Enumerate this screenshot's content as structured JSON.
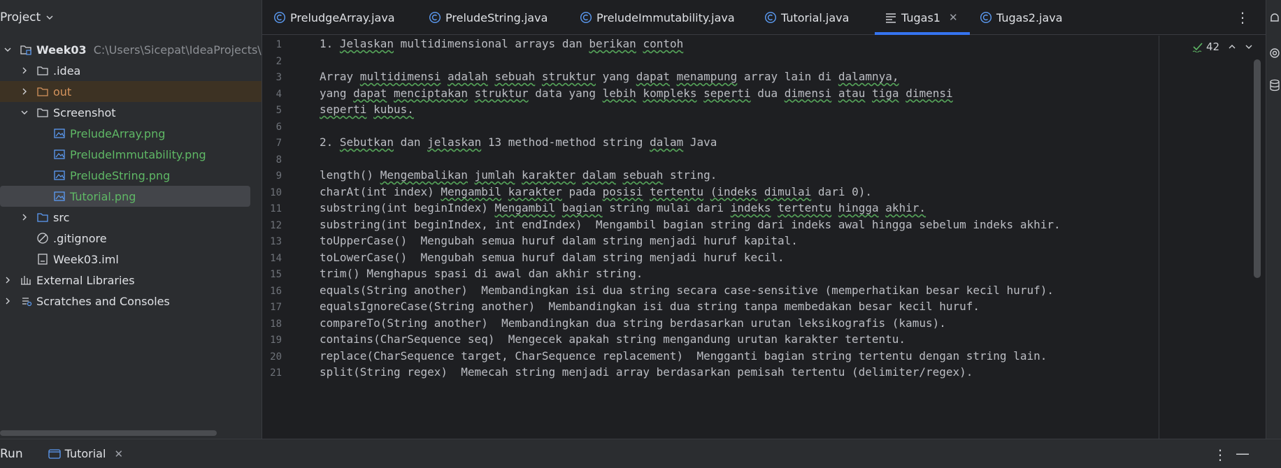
{
  "project": {
    "title": "Project",
    "tree": [
      {
        "label": "Week03",
        "path": "C:\\Users\\Sicepat\\IdeaProjects\\W",
        "icon": "module-folder-icon"
      },
      {
        "label": ".idea",
        "icon": "folder-icon"
      },
      {
        "label": "out",
        "icon": "folder-icon"
      },
      {
        "label": "Screenshot",
        "icon": "folder-icon"
      },
      {
        "label": "PreludeArray.png",
        "icon": "image-file-icon"
      },
      {
        "label": "PreludeImmutability.png",
        "icon": "image-file-icon"
      },
      {
        "label": "PreludeString.png",
        "icon": "image-file-icon"
      },
      {
        "label": "Tutorial.png",
        "icon": "image-file-icon"
      },
      {
        "label": "src",
        "icon": "folder-icon"
      },
      {
        "label": ".gitignore",
        "icon": "ignore-file-icon"
      },
      {
        "label": "Week03.iml",
        "icon": "iml-file-icon"
      },
      {
        "label": "External Libraries",
        "icon": "libraries-icon"
      },
      {
        "label": "Scratches and Consoles",
        "icon": "scratches-icon"
      }
    ]
  },
  "tabs": [
    {
      "label": "PreludgeArray.java",
      "icon": "java-class-icon"
    },
    {
      "label": "PreludeString.java",
      "icon": "java-class-icon"
    },
    {
      "label": "PreludeImmutability.java",
      "icon": "java-class-icon"
    },
    {
      "label": "Tutorial.java",
      "icon": "java-class-icon"
    },
    {
      "label": "Tugas1",
      "icon": "text-file-icon",
      "active": true
    },
    {
      "label": "Tugas2.java",
      "icon": "java-class-icon"
    }
  ],
  "editor": {
    "inspection_count": "42",
    "line_numbers": [
      "1",
      "2",
      "3",
      "4",
      "5",
      "6",
      "7",
      "8",
      "9",
      "10",
      "11",
      "12",
      "13",
      "14",
      "15",
      "16",
      "17",
      "18",
      "19",
      "20",
      "21"
    ],
    "lines": [
      "1. Jelaskan multidimensional arrays dan berikan contoh",
      "",
      "Array multidimensi adalah sebuah struktur yang dapat menampung array lain di dalamnya,",
      "yang dapat menciptakan struktur data yang lebih kompleks seperti dua dimensi atau tiga dimensi",
      "seperti kubus.",
      "",
      "2. Sebutkan dan jelaskan 13 method-method string dalam Java",
      "",
      "length() Mengembalikan jumlah karakter dalam sebuah string.",
      "charAt(int index) Mengambil karakter pada posisi tertentu (indeks dimulai dari 0).",
      "substring(int beginIndex) Mengambil bagian string mulai dari indeks tertentu hingga akhir.",
      "substring(int beginIndex, int endIndex)  Mengambil bagian string dari indeks awal hingga sebelum indeks akhir.",
      "toUpperCase()  Mengubah semua huruf dalam string menjadi huruf kapital.",
      "toLowerCase()  Mengubah semua huruf dalam string menjadi huruf kecil.",
      "trim() Menghapus spasi di awal dan akhir string.",
      "equals(String another)  Membandingkan isi dua string secara case-sensitive (memperhatikan besar kecil huruf).",
      "equalsIgnoreCase(String another)  Membandingkan isi dua string tanpa membedakan besar kecil huruf.",
      "compareTo(String another)  Membandingkan dua string berdasarkan urutan leksikografis (kamus).",
      "contains(CharSequence seq)  Mengecek apakah string mengandung urutan karakter tertentu.",
      "replace(CharSequence target, CharSequence replacement)  Mengganti bagian string tertentu dengan string lain.",
      "split(String regex)  Memecah string menjadi array berdasarkan pemisah tertentu (delimiter/regex)."
    ]
  },
  "run": {
    "label": "Run",
    "tab_label": "Tutorial"
  },
  "colors": {
    "accent": "#3574f0",
    "image_file": "#5fb865",
    "excluded_folder": "#d4935d"
  }
}
